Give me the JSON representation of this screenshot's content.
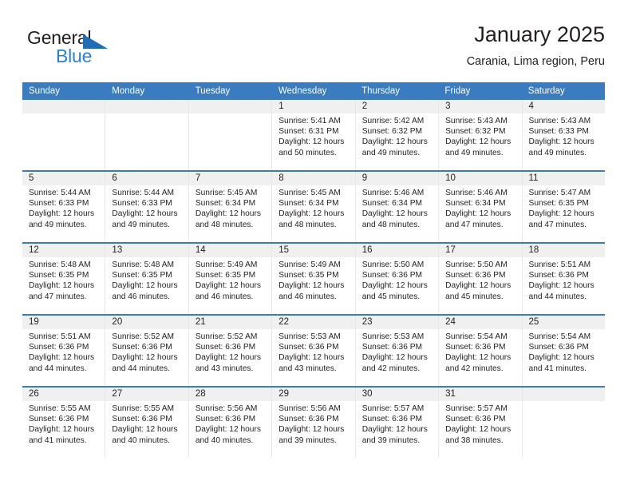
{
  "brand": {
    "name_top": "General",
    "name_bottom": "Blue"
  },
  "header": {
    "title": "January 2025",
    "subtitle": "Carania, Lima region, Peru"
  },
  "calendar": {
    "weekdays": [
      "Sunday",
      "Monday",
      "Tuesday",
      "Wednesday",
      "Thursday",
      "Friday",
      "Saturday"
    ],
    "labels": {
      "sunrise": "Sunrise:",
      "sunset": "Sunset:",
      "daylight": "Daylight:"
    },
    "colors": {
      "header_blue": "#3b7cc0",
      "daynum_band": "#f0f0f0",
      "text": "#231f20",
      "brand_blue": "#2980d4"
    },
    "weeks": [
      [
        {
          "day": "",
          "empty": true
        },
        {
          "day": "",
          "empty": true
        },
        {
          "day": "",
          "empty": true
        },
        {
          "day": "1",
          "sunrise": "Sunrise: 5:41 AM",
          "sunset": "Sunset: 6:31 PM",
          "daylight_1": "Daylight: 12 hours",
          "daylight_2": "and 50 minutes."
        },
        {
          "day": "2",
          "sunrise": "Sunrise: 5:42 AM",
          "sunset": "Sunset: 6:32 PM",
          "daylight_1": "Daylight: 12 hours",
          "daylight_2": "and 49 minutes."
        },
        {
          "day": "3",
          "sunrise": "Sunrise: 5:43 AM",
          "sunset": "Sunset: 6:32 PM",
          "daylight_1": "Daylight: 12 hours",
          "daylight_2": "and 49 minutes."
        },
        {
          "day": "4",
          "sunrise": "Sunrise: 5:43 AM",
          "sunset": "Sunset: 6:33 PM",
          "daylight_1": "Daylight: 12 hours",
          "daylight_2": "and 49 minutes."
        }
      ],
      [
        {
          "day": "5",
          "sunrise": "Sunrise: 5:44 AM",
          "sunset": "Sunset: 6:33 PM",
          "daylight_1": "Daylight: 12 hours",
          "daylight_2": "and 49 minutes."
        },
        {
          "day": "6",
          "sunrise": "Sunrise: 5:44 AM",
          "sunset": "Sunset: 6:33 PM",
          "daylight_1": "Daylight: 12 hours",
          "daylight_2": "and 49 minutes."
        },
        {
          "day": "7",
          "sunrise": "Sunrise: 5:45 AM",
          "sunset": "Sunset: 6:34 PM",
          "daylight_1": "Daylight: 12 hours",
          "daylight_2": "and 48 minutes."
        },
        {
          "day": "8",
          "sunrise": "Sunrise: 5:45 AM",
          "sunset": "Sunset: 6:34 PM",
          "daylight_1": "Daylight: 12 hours",
          "daylight_2": "and 48 minutes."
        },
        {
          "day": "9",
          "sunrise": "Sunrise: 5:46 AM",
          "sunset": "Sunset: 6:34 PM",
          "daylight_1": "Daylight: 12 hours",
          "daylight_2": "and 48 minutes."
        },
        {
          "day": "10",
          "sunrise": "Sunrise: 5:46 AM",
          "sunset": "Sunset: 6:34 PM",
          "daylight_1": "Daylight: 12 hours",
          "daylight_2": "and 47 minutes."
        },
        {
          "day": "11",
          "sunrise": "Sunrise: 5:47 AM",
          "sunset": "Sunset: 6:35 PM",
          "daylight_1": "Daylight: 12 hours",
          "daylight_2": "and 47 minutes."
        }
      ],
      [
        {
          "day": "12",
          "sunrise": "Sunrise: 5:48 AM",
          "sunset": "Sunset: 6:35 PM",
          "daylight_1": "Daylight: 12 hours",
          "daylight_2": "and 47 minutes."
        },
        {
          "day": "13",
          "sunrise": "Sunrise: 5:48 AM",
          "sunset": "Sunset: 6:35 PM",
          "daylight_1": "Daylight: 12 hours",
          "daylight_2": "and 46 minutes."
        },
        {
          "day": "14",
          "sunrise": "Sunrise: 5:49 AM",
          "sunset": "Sunset: 6:35 PM",
          "daylight_1": "Daylight: 12 hours",
          "daylight_2": "and 46 minutes."
        },
        {
          "day": "15",
          "sunrise": "Sunrise: 5:49 AM",
          "sunset": "Sunset: 6:35 PM",
          "daylight_1": "Daylight: 12 hours",
          "daylight_2": "and 46 minutes."
        },
        {
          "day": "16",
          "sunrise": "Sunrise: 5:50 AM",
          "sunset": "Sunset: 6:36 PM",
          "daylight_1": "Daylight: 12 hours",
          "daylight_2": "and 45 minutes."
        },
        {
          "day": "17",
          "sunrise": "Sunrise: 5:50 AM",
          "sunset": "Sunset: 6:36 PM",
          "daylight_1": "Daylight: 12 hours",
          "daylight_2": "and 45 minutes."
        },
        {
          "day": "18",
          "sunrise": "Sunrise: 5:51 AM",
          "sunset": "Sunset: 6:36 PM",
          "daylight_1": "Daylight: 12 hours",
          "daylight_2": "and 44 minutes."
        }
      ],
      [
        {
          "day": "19",
          "sunrise": "Sunrise: 5:51 AM",
          "sunset": "Sunset: 6:36 PM",
          "daylight_1": "Daylight: 12 hours",
          "daylight_2": "and 44 minutes."
        },
        {
          "day": "20",
          "sunrise": "Sunrise: 5:52 AM",
          "sunset": "Sunset: 6:36 PM",
          "daylight_1": "Daylight: 12 hours",
          "daylight_2": "and 44 minutes."
        },
        {
          "day": "21",
          "sunrise": "Sunrise: 5:52 AM",
          "sunset": "Sunset: 6:36 PM",
          "daylight_1": "Daylight: 12 hours",
          "daylight_2": "and 43 minutes."
        },
        {
          "day": "22",
          "sunrise": "Sunrise: 5:53 AM",
          "sunset": "Sunset: 6:36 PM",
          "daylight_1": "Daylight: 12 hours",
          "daylight_2": "and 43 minutes."
        },
        {
          "day": "23",
          "sunrise": "Sunrise: 5:53 AM",
          "sunset": "Sunset: 6:36 PM",
          "daylight_1": "Daylight: 12 hours",
          "daylight_2": "and 42 minutes."
        },
        {
          "day": "24",
          "sunrise": "Sunrise: 5:54 AM",
          "sunset": "Sunset: 6:36 PM",
          "daylight_1": "Daylight: 12 hours",
          "daylight_2": "and 42 minutes."
        },
        {
          "day": "25",
          "sunrise": "Sunrise: 5:54 AM",
          "sunset": "Sunset: 6:36 PM",
          "daylight_1": "Daylight: 12 hours",
          "daylight_2": "and 41 minutes."
        }
      ],
      [
        {
          "day": "26",
          "sunrise": "Sunrise: 5:55 AM",
          "sunset": "Sunset: 6:36 PM",
          "daylight_1": "Daylight: 12 hours",
          "daylight_2": "and 41 minutes."
        },
        {
          "day": "27",
          "sunrise": "Sunrise: 5:55 AM",
          "sunset": "Sunset: 6:36 PM",
          "daylight_1": "Daylight: 12 hours",
          "daylight_2": "and 40 minutes."
        },
        {
          "day": "28",
          "sunrise": "Sunrise: 5:56 AM",
          "sunset": "Sunset: 6:36 PM",
          "daylight_1": "Daylight: 12 hours",
          "daylight_2": "and 40 minutes."
        },
        {
          "day": "29",
          "sunrise": "Sunrise: 5:56 AM",
          "sunset": "Sunset: 6:36 PM",
          "daylight_1": "Daylight: 12 hours",
          "daylight_2": "and 39 minutes."
        },
        {
          "day": "30",
          "sunrise": "Sunrise: 5:57 AM",
          "sunset": "Sunset: 6:36 PM",
          "daylight_1": "Daylight: 12 hours",
          "daylight_2": "and 39 minutes."
        },
        {
          "day": "31",
          "sunrise": "Sunrise: 5:57 AM",
          "sunset": "Sunset: 6:36 PM",
          "daylight_1": "Daylight: 12 hours",
          "daylight_2": "and 38 minutes."
        },
        {
          "day": "",
          "empty": true
        }
      ]
    ]
  }
}
